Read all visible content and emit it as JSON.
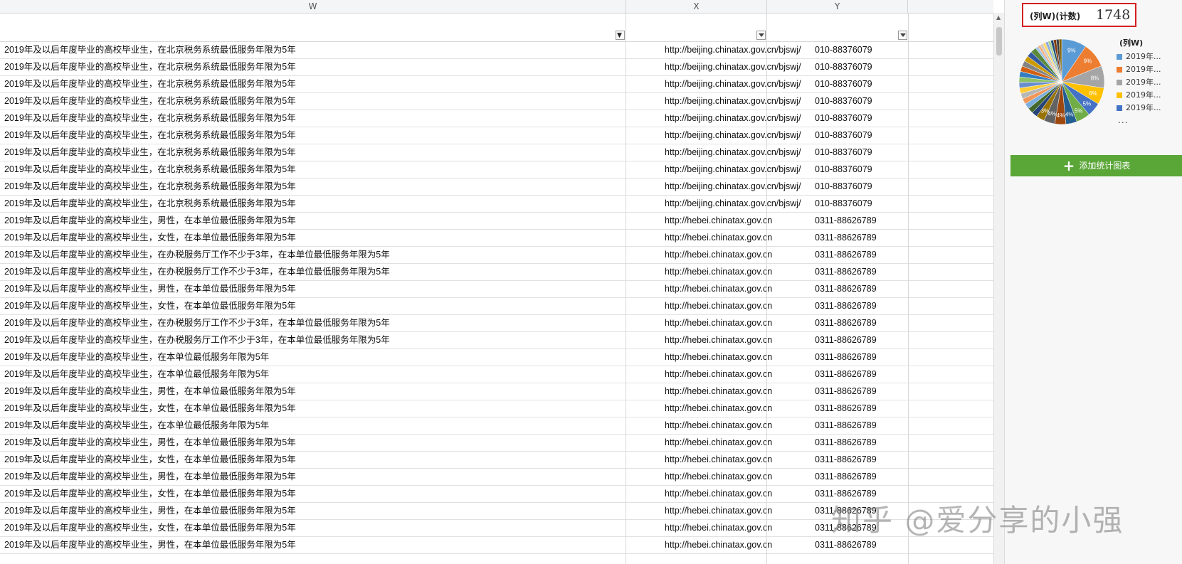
{
  "columns": [
    {
      "id": "W",
      "label": "W"
    },
    {
      "id": "X",
      "label": "X"
    },
    {
      "id": "Y",
      "label": "Y"
    }
  ],
  "rows": [
    {
      "w": "2019年及以后年度毕业的高校毕业生，在北京税务系统最低服务年限为5年",
      "x": "http://beijing.chinatax.gov.cn/bjswj/",
      "y": "010-88376079"
    },
    {
      "w": "2019年及以后年度毕业的高校毕业生，在北京税务系统最低服务年限为5年",
      "x": "http://beijing.chinatax.gov.cn/bjswj/",
      "y": "010-88376079"
    },
    {
      "w": "2019年及以后年度毕业的高校毕业生，在北京税务系统最低服务年限为5年",
      "x": "http://beijing.chinatax.gov.cn/bjswj/",
      "y": "010-88376079"
    },
    {
      "w": "2019年及以后年度毕业的高校毕业生，在北京税务系统最低服务年限为5年",
      "x": "http://beijing.chinatax.gov.cn/bjswj/",
      "y": "010-88376079"
    },
    {
      "w": "2019年及以后年度毕业的高校毕业生，在北京税务系统最低服务年限为5年",
      "x": "http://beijing.chinatax.gov.cn/bjswj/",
      "y": "010-88376079"
    },
    {
      "w": "2019年及以后年度毕业的高校毕业生，在北京税务系统最低服务年限为5年",
      "x": "http://beijing.chinatax.gov.cn/bjswj/",
      "y": "010-88376079"
    },
    {
      "w": "2019年及以后年度毕业的高校毕业生，在北京税务系统最低服务年限为5年",
      "x": "http://beijing.chinatax.gov.cn/bjswj/",
      "y": "010-88376079"
    },
    {
      "w": "2019年及以后年度毕业的高校毕业生，在北京税务系统最低服务年限为5年",
      "x": "http://beijing.chinatax.gov.cn/bjswj/",
      "y": "010-88376079"
    },
    {
      "w": "2019年及以后年度毕业的高校毕业生，在北京税务系统最低服务年限为5年",
      "x": "http://beijing.chinatax.gov.cn/bjswj/",
      "y": "010-88376079"
    },
    {
      "w": "2019年及以后年度毕业的高校毕业生，在北京税务系统最低服务年限为5年",
      "x": "http://beijing.chinatax.gov.cn/bjswj/",
      "y": "010-88376079"
    },
    {
      "w": "2019年及以后年度毕业的高校毕业生，男性，在本单位最低服务年限为5年",
      "x": "http://hebei.chinatax.gov.cn",
      "y": "0311-88626789"
    },
    {
      "w": "2019年及以后年度毕业的高校毕业生，女性，在本单位最低服务年限为5年",
      "x": "http://hebei.chinatax.gov.cn",
      "y": "0311-88626789"
    },
    {
      "w": "2019年及以后年度毕业的高校毕业生，在办税服务厅工作不少于3年，在本单位最低服务年限为5年",
      "x": "http://hebei.chinatax.gov.cn",
      "y": "0311-88626789"
    },
    {
      "w": "2019年及以后年度毕业的高校毕业生，在办税服务厅工作不少于3年，在本单位最低服务年限为5年",
      "x": "http://hebei.chinatax.gov.cn",
      "y": "0311-88626789"
    },
    {
      "w": "2019年及以后年度毕业的高校毕业生，男性，在本单位最低服务年限为5年",
      "x": "http://hebei.chinatax.gov.cn",
      "y": "0311-88626789"
    },
    {
      "w": "2019年及以后年度毕业的高校毕业生，女性，在本单位最低服务年限为5年",
      "x": "http://hebei.chinatax.gov.cn",
      "y": "0311-88626789"
    },
    {
      "w": "2019年及以后年度毕业的高校毕业生，在办税服务厅工作不少于3年，在本单位最低服务年限为5年",
      "x": "http://hebei.chinatax.gov.cn",
      "y": "0311-88626789"
    },
    {
      "w": "2019年及以后年度毕业的高校毕业生，在办税服务厅工作不少于3年，在本单位最低服务年限为5年",
      "x": "http://hebei.chinatax.gov.cn",
      "y": "0311-88626789"
    },
    {
      "w": "2019年及以后年度毕业的高校毕业生，在本单位最低服务年限为5年",
      "x": "http://hebei.chinatax.gov.cn",
      "y": "0311-88626789"
    },
    {
      "w": "2019年及以后年度毕业的高校毕业生，在本单位最低服务年限为5年",
      "x": "http://hebei.chinatax.gov.cn",
      "y": "0311-88626789"
    },
    {
      "w": "2019年及以后年度毕业的高校毕业生，男性，在本单位最低服务年限为5年",
      "x": "http://hebei.chinatax.gov.cn",
      "y": "0311-88626789"
    },
    {
      "w": "2019年及以后年度毕业的高校毕业生，女性，在本单位最低服务年限为5年",
      "x": "http://hebei.chinatax.gov.cn",
      "y": "0311-88626789"
    },
    {
      "w": "2019年及以后年度毕业的高校毕业生，在本单位最低服务年限为5年",
      "x": "http://hebei.chinatax.gov.cn",
      "y": "0311-88626789"
    },
    {
      "w": "2019年及以后年度毕业的高校毕业生，男性，在本单位最低服务年限为5年",
      "x": "http://hebei.chinatax.gov.cn",
      "y": "0311-88626789"
    },
    {
      "w": "2019年及以后年度毕业的高校毕业生，女性，在本单位最低服务年限为5年",
      "x": "http://hebei.chinatax.gov.cn",
      "y": "0311-88626789"
    },
    {
      "w": "2019年及以后年度毕业的高校毕业生，男性，在本单位最低服务年限为5年",
      "x": "http://hebei.chinatax.gov.cn",
      "y": "0311-88626789"
    },
    {
      "w": "2019年及以后年度毕业的高校毕业生，女性，在本单位最低服务年限为5年",
      "x": "http://hebei.chinatax.gov.cn",
      "y": "0311-88626789"
    },
    {
      "w": "2019年及以后年度毕业的高校毕业生，男性，在本单位最低服务年限为5年",
      "x": "http://hebei.chinatax.gov.cn",
      "y": "0311-88626789"
    },
    {
      "w": "2019年及以后年度毕业的高校毕业生，女性，在本单位最低服务年限为5年",
      "x": "http://hebei.chinatax.gov.cn",
      "y": "0311-88626789"
    },
    {
      "w": "2019年及以后年度毕业的高校毕业生，男性，在本单位最低服务年限为5年",
      "x": "http://hebei.chinatax.gov.cn",
      "y": "0311-88626789"
    }
  ],
  "stats_panel": {
    "stat_label": "(列W)(计数)",
    "stat_value": "1748",
    "legend_title": "(列W)",
    "legend_more": "...",
    "add_chart_label": "添加统计图表",
    "add_chart_icon": "plus-icon"
  },
  "chart_data": {
    "type": "pie",
    "legend": [
      "2019年...",
      "2019年...",
      "2019年...",
      "2019年...",
      "2019年..."
    ],
    "slices": [
      {
        "value": 9,
        "label": "9%",
        "color": "#5b9bd5"
      },
      {
        "value": 9,
        "label": "9%",
        "color": "#ed7d31"
      },
      {
        "value": 8,
        "label": "8%",
        "color": "#a5a5a5"
      },
      {
        "value": 6,
        "label": "6%",
        "color": "#ffc000"
      },
      {
        "value": 5,
        "label": "5%",
        "color": "#4472c4"
      },
      {
        "value": 5,
        "label": "5%",
        "color": "#70ad47"
      },
      {
        "value": 4,
        "label": "4%",
        "color": "#255e91"
      },
      {
        "value": 4,
        "label": "4%",
        "color": "#9e480e"
      },
      {
        "value": 4,
        "label": "4%",
        "color": "#636363"
      },
      {
        "value": 3,
        "label": "3%",
        "color": "#997300"
      },
      {
        "value": 2,
        "label": "",
        "color": "#264478"
      },
      {
        "value": 2,
        "label": "",
        "color": "#43682b"
      },
      {
        "value": 2,
        "label": "",
        "color": "#7cafdd"
      },
      {
        "value": 2,
        "label": "",
        "color": "#f1975a"
      },
      {
        "value": 2,
        "label": "",
        "color": "#b7b7b7"
      },
      {
        "value": 2,
        "label": "",
        "color": "#ffcd33"
      },
      {
        "value": 2,
        "label": "",
        "color": "#698ed0"
      },
      {
        "value": 2,
        "label": "",
        "color": "#8cc168"
      },
      {
        "value": 2,
        "label": "",
        "color": "#327dc2"
      },
      {
        "value": 2,
        "label": "",
        "color": "#d26012"
      },
      {
        "value": 2,
        "label": "",
        "color": "#848484"
      },
      {
        "value": 2,
        "label": "",
        "color": "#cc9a00"
      },
      {
        "value": 2,
        "label": "",
        "color": "#335aa1"
      },
      {
        "value": 2,
        "label": "",
        "color": "#5a8a39"
      },
      {
        "value": 1,
        "label": "",
        "color": "#9dc3e6"
      },
      {
        "value": 1,
        "label": "",
        "color": "#f4b183"
      },
      {
        "value": 1,
        "label": "",
        "color": "#c9c9c9"
      },
      {
        "value": 1,
        "label": "",
        "color": "#ffd966"
      },
      {
        "value": 1,
        "label": "",
        "color": "#8faadc"
      },
      {
        "value": 1,
        "label": "",
        "color": "#a9d18e"
      },
      {
        "value": 1,
        "label": "",
        "color": "#1f4e79"
      },
      {
        "value": 1,
        "label": "",
        "color": "#843c0c"
      },
      {
        "value": 1,
        "label": "",
        "color": "#404040"
      },
      {
        "value": 1,
        "label": "",
        "color": "#7f6000"
      }
    ]
  },
  "watermark": "知乎 @爱分享的小强"
}
